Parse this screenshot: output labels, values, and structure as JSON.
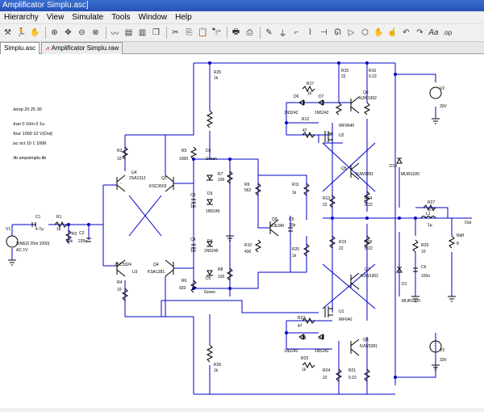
{
  "window": {
    "title": "Amplificator Simplu.asc]"
  },
  "menu": [
    "Hierarchy",
    "View",
    "Simulate",
    "Tools",
    "Window",
    "Help"
  ],
  "toolbar_icons": [
    "hammer-icon",
    "run-icon",
    "halt-icon",
    "zoom-in-icon",
    "zoom-pan-icon",
    "zoom-out-icon",
    "zoom-fit-icon",
    "waveform-icon",
    "tile-horizontal-icon",
    "tile-vertical-icon",
    "cascade-icon",
    "cut-icon",
    "copy-icon",
    "paste-icon",
    "find-icon",
    "print-setup-icon",
    "print-icon",
    "wire-icon",
    "ground-icon",
    "label-icon",
    "resistor-icon",
    "capacitor-icon",
    "inductor-icon",
    "diode-icon",
    "component-icon",
    "move-icon",
    "drag-icon",
    "undo-icon",
    "redo-icon",
    "text-icon",
    "spice-directive-icon"
  ],
  "tabs": [
    {
      "label": "Simplu.asc",
      "icon": "schematic-icon",
      "active": true
    },
    {
      "label": "Amplificator Simplu.raw",
      "icon": "waveform-icon",
      "active": false
    }
  ],
  "directives": [
    ".temp 20 25 30",
    ".tran 0 10m 0 1u",
    ".four 1000 10 V(Out)",
    ";ac oct 10 1 100K",
    ".lib ampsimplu.lib"
  ],
  "labels": {
    "r25": "R25",
    "r25v": "1k",
    "r26": "R26",
    "r26v": "1k",
    "r15": "R15",
    "r15v": "22",
    "r16": "R16",
    "r16v": "0.22",
    "q6": "Q6",
    "q6v": "NJW1302",
    "r17": "R17",
    "r17v": "1k",
    "d6": "D6",
    "d6v": "1N5242",
    "d7": "D7",
    "d7v": "1N5242",
    "r12": "R12",
    "r12v": "47",
    "irf9640": "IRF9640",
    "u2": "U2",
    "r3": "R3",
    "r3v": "10",
    "r5": "R5",
    "r5v": "1000",
    "d2": "D2",
    "d2v": "Green",
    "u4": "U4",
    "u4v": "2SA1312",
    "q2": "Q2",
    "q2v": "KSC3503",
    "r7": "R7",
    "r7v": "100",
    "c3": "C3",
    "c3v": "1m",
    "d3": "D3",
    "d3v": "1N5245",
    "r9": "R9",
    "r9v": "562",
    "r11": "R11",
    "r11v": "1k",
    "q9": "Q9",
    "q9v": "MJE340",
    "c5": "C5",
    "c5v": "10p",
    "q5": "Q5",
    "q5v": "NJW3281",
    "r13": "R13",
    "r13v": "22",
    "r14": "R14",
    "r14v": "0.22",
    "d10": "D10",
    "d10v": "MURS320",
    "v2": "V2",
    "v2v": "33V",
    "r27": "R27",
    "r27v": "2.2",
    "l1": "L1",
    "l1v": "1µ",
    "out": "Out",
    "v1": "V1",
    "v1v": "SINE(0 20m 1000)",
    "v1ac": "AC 1V",
    "c1": "C1",
    "c1v": "4.7µ",
    "r1": "R1",
    "r1v": "1k",
    "r2": "R2",
    "r2v": "10k",
    "c2": "C2",
    "c2v": "220p",
    "c4": "C4",
    "c4v": "1m",
    "d4": "D4",
    "d4v": "1N5245",
    "r10": "R10",
    "r10v": "430",
    "r20": "R20",
    "r20v": "1k",
    "r19": "R19",
    "r19v": "22",
    "r18": "R18",
    "r18v": "0.22",
    "q7": "Q7",
    "q7v": "NJW1302",
    "r29": "R29",
    "r29v": "10",
    "c6": "C6",
    "c6v": "100n",
    "rdif": "Rdif",
    "rdifv": "8",
    "d1": "D1",
    "d1v": "MURS320",
    "u3": "U3",
    "u3v": "2SC3324",
    "q4": "Q4",
    "q4v": "KSA1381",
    "r4": "R4",
    "r4v": "10",
    "r6": "R6",
    "r6v": "933",
    "d5": "D5",
    "d5v": "Green",
    "r8": "R8",
    "r8v": "100",
    "u1": "U1",
    "irf640": "IRF640",
    "r22": "R22",
    "r22v": "47",
    "d8": "D8",
    "d8v": "1N5242",
    "d9": "D9",
    "d9v": "1N5242",
    "q8": "Q8",
    "q8v": "NJW3281",
    "r23": "R23",
    "r23v": "1k",
    "r24": "R24",
    "r24v": "22",
    "r21": "R21",
    "r21v": "0.22",
    "v3": "V3",
    "v3v": "33V"
  },
  "colors": {
    "wire": "#0000c8",
    "component": "#000000",
    "node": "#0000c8",
    "titlebar": "#2553b5"
  }
}
